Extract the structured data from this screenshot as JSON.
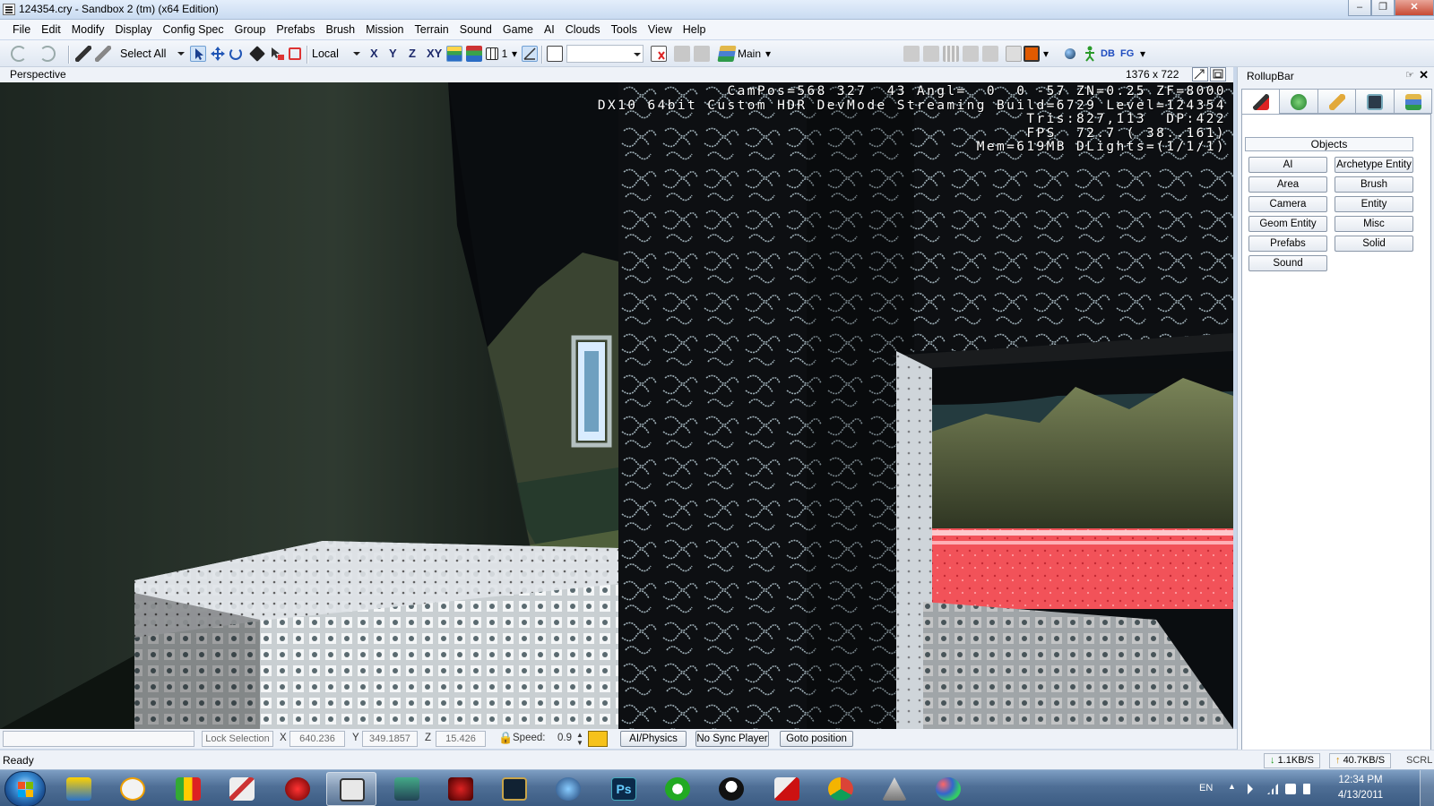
{
  "window": {
    "title": "124354.cry - Sandbox 2 (tm) (x64 Edition)",
    "controls": [
      "minimize",
      "maximize",
      "close"
    ]
  },
  "menu": [
    "File",
    "Edit",
    "Modify",
    "Display",
    "Config Spec",
    "Group",
    "Prefabs",
    "Brush",
    "Mission",
    "Terrain",
    "Sound",
    "Game",
    "AI",
    "Clouds",
    "Tools",
    "View",
    "Help"
  ],
  "toolbar": {
    "select_all": "Select All",
    "coord_system": "Local",
    "axis_x": "X",
    "axis_y": "Y",
    "axis_z": "Z",
    "axis_xy": "XY",
    "grid_value": "1",
    "layer": "Main",
    "db_label": "DB",
    "fg_label": "FG"
  },
  "viewport": {
    "name": "Perspective",
    "resolution": "1376 x 722",
    "hud": [
      "CamPos=568 327  43 Angl=  0  0 -57 ZN=0.25 ZF=8000",
      "DX10 64bit Custom HDR DevMode Streaming Build=6729 Level=124354",
      "Tris:827,113  DP:422",
      "FPS  72.7 ( 38..161)",
      "Mem=619MB DLights=(1/1/1)"
    ]
  },
  "rollup": {
    "title": "RollupBar",
    "section": "Objects",
    "buttons_left": [
      "AI",
      "Area",
      "Camera",
      "Geom Entity",
      "Prefabs",
      "Sound"
    ],
    "buttons_right": [
      "Archetype Entity",
      "Brush",
      "Entity",
      "Misc",
      "Solid"
    ]
  },
  "navbar": {
    "lock_selection": "Lock Selection",
    "x_label": "X",
    "x_value": "640.236",
    "y_label": "Y",
    "y_value": "349.1857",
    "z_label": "Z",
    "z_value": "15.426",
    "speed_label": "Speed:",
    "speed_value": "0.9",
    "ai_physics": "AI/Physics",
    "no_sync": "No Sync Player",
    "goto": "Goto position"
  },
  "status": {
    "ready": "Ready",
    "download": "1.1KB/S",
    "upload": "40.7KB/S",
    "scroll": "SCRL"
  },
  "taskbar": {
    "lang": "EN",
    "time": "12:34 PM",
    "date": "4/13/2011",
    "ps_label": "Ps"
  }
}
